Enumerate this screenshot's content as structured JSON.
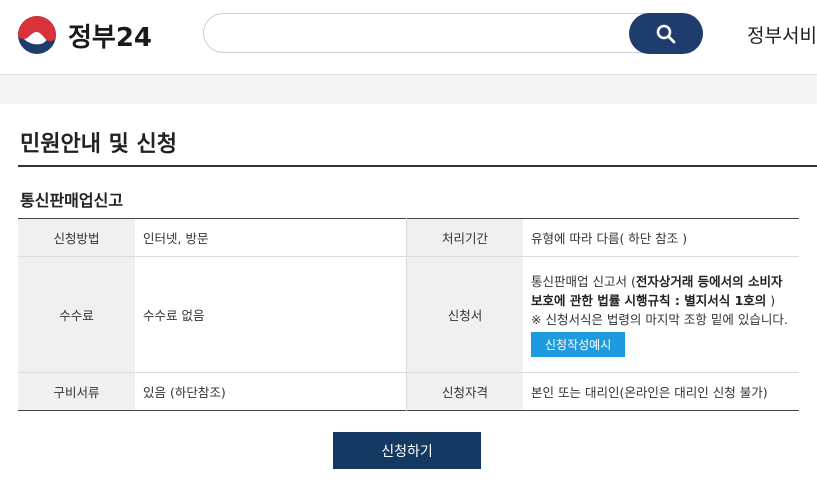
{
  "header": {
    "logo_text": "정부24",
    "search_placeholder": "",
    "nav_text": "정부서비스"
  },
  "page": {
    "title": "민원안내 및 신청",
    "section_title": "통신판매업신고"
  },
  "table": {
    "method_label": "신청방법",
    "method_value": "인터넷, 방문",
    "period_label": "처리기간",
    "period_value": "유형에 따라 다름( 하단 참조 )",
    "fee_label": "수수료",
    "fee_value": "수수료 없음",
    "form_label": "신청서",
    "form_value_prefix": "통신판매업 신고서 (",
    "form_value_bold": "전자상거래 등에서의 소비자 보호에 관한 법률 시행규칙 : 별지서식 1호의",
    "form_value_suffix": " )",
    "form_note": "※ 신청서식은 법령의 마지막 조항 밑에 있습니다.",
    "form_sample_button": "신청작성예시",
    "docs_label": "구비서류",
    "docs_value": "있음 (하단참조)",
    "eligibility_label": "신청자격",
    "eligibility_value": "본인 또는 대리인(온라인은 대리인 신청 불가)"
  },
  "apply_button": "신청하기",
  "colors": {
    "brand_navy": "#1f3d6c",
    "button_navy": "#143a64",
    "accent_blue": "#1e9be0",
    "logo_red": "#d8333a"
  }
}
